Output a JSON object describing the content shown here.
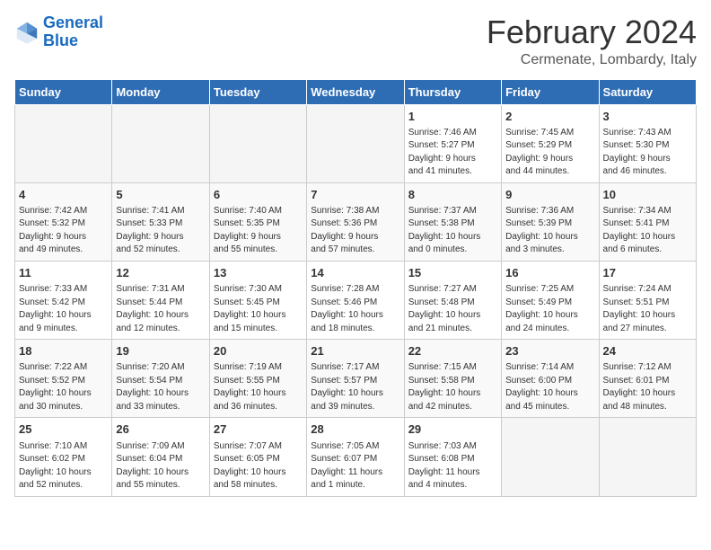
{
  "header": {
    "logo_general": "General",
    "logo_blue": "Blue",
    "month_title": "February 2024",
    "location": "Cermenate, Lombardy, Italy"
  },
  "calendar": {
    "days_of_week": [
      "Sunday",
      "Monday",
      "Tuesday",
      "Wednesday",
      "Thursday",
      "Friday",
      "Saturday"
    ],
    "weeks": [
      [
        {
          "day": "",
          "data": ""
        },
        {
          "day": "",
          "data": ""
        },
        {
          "day": "",
          "data": ""
        },
        {
          "day": "",
          "data": ""
        },
        {
          "day": "1",
          "data": "Sunrise: 7:46 AM\nSunset: 5:27 PM\nDaylight: 9 hours\nand 41 minutes."
        },
        {
          "day": "2",
          "data": "Sunrise: 7:45 AM\nSunset: 5:29 PM\nDaylight: 9 hours\nand 44 minutes."
        },
        {
          "day": "3",
          "data": "Sunrise: 7:43 AM\nSunset: 5:30 PM\nDaylight: 9 hours\nand 46 minutes."
        }
      ],
      [
        {
          "day": "4",
          "data": "Sunrise: 7:42 AM\nSunset: 5:32 PM\nDaylight: 9 hours\nand 49 minutes."
        },
        {
          "day": "5",
          "data": "Sunrise: 7:41 AM\nSunset: 5:33 PM\nDaylight: 9 hours\nand 52 minutes."
        },
        {
          "day": "6",
          "data": "Sunrise: 7:40 AM\nSunset: 5:35 PM\nDaylight: 9 hours\nand 55 minutes."
        },
        {
          "day": "7",
          "data": "Sunrise: 7:38 AM\nSunset: 5:36 PM\nDaylight: 9 hours\nand 57 minutes."
        },
        {
          "day": "8",
          "data": "Sunrise: 7:37 AM\nSunset: 5:38 PM\nDaylight: 10 hours\nand 0 minutes."
        },
        {
          "day": "9",
          "data": "Sunrise: 7:36 AM\nSunset: 5:39 PM\nDaylight: 10 hours\nand 3 minutes."
        },
        {
          "day": "10",
          "data": "Sunrise: 7:34 AM\nSunset: 5:41 PM\nDaylight: 10 hours\nand 6 minutes."
        }
      ],
      [
        {
          "day": "11",
          "data": "Sunrise: 7:33 AM\nSunset: 5:42 PM\nDaylight: 10 hours\nand 9 minutes."
        },
        {
          "day": "12",
          "data": "Sunrise: 7:31 AM\nSunset: 5:44 PM\nDaylight: 10 hours\nand 12 minutes."
        },
        {
          "day": "13",
          "data": "Sunrise: 7:30 AM\nSunset: 5:45 PM\nDaylight: 10 hours\nand 15 minutes."
        },
        {
          "day": "14",
          "data": "Sunrise: 7:28 AM\nSunset: 5:46 PM\nDaylight: 10 hours\nand 18 minutes."
        },
        {
          "day": "15",
          "data": "Sunrise: 7:27 AM\nSunset: 5:48 PM\nDaylight: 10 hours\nand 21 minutes."
        },
        {
          "day": "16",
          "data": "Sunrise: 7:25 AM\nSunset: 5:49 PM\nDaylight: 10 hours\nand 24 minutes."
        },
        {
          "day": "17",
          "data": "Sunrise: 7:24 AM\nSunset: 5:51 PM\nDaylight: 10 hours\nand 27 minutes."
        }
      ],
      [
        {
          "day": "18",
          "data": "Sunrise: 7:22 AM\nSunset: 5:52 PM\nDaylight: 10 hours\nand 30 minutes."
        },
        {
          "day": "19",
          "data": "Sunrise: 7:20 AM\nSunset: 5:54 PM\nDaylight: 10 hours\nand 33 minutes."
        },
        {
          "day": "20",
          "data": "Sunrise: 7:19 AM\nSunset: 5:55 PM\nDaylight: 10 hours\nand 36 minutes."
        },
        {
          "day": "21",
          "data": "Sunrise: 7:17 AM\nSunset: 5:57 PM\nDaylight: 10 hours\nand 39 minutes."
        },
        {
          "day": "22",
          "data": "Sunrise: 7:15 AM\nSunset: 5:58 PM\nDaylight: 10 hours\nand 42 minutes."
        },
        {
          "day": "23",
          "data": "Sunrise: 7:14 AM\nSunset: 6:00 PM\nDaylight: 10 hours\nand 45 minutes."
        },
        {
          "day": "24",
          "data": "Sunrise: 7:12 AM\nSunset: 6:01 PM\nDaylight: 10 hours\nand 48 minutes."
        }
      ],
      [
        {
          "day": "25",
          "data": "Sunrise: 7:10 AM\nSunset: 6:02 PM\nDaylight: 10 hours\nand 52 minutes."
        },
        {
          "day": "26",
          "data": "Sunrise: 7:09 AM\nSunset: 6:04 PM\nDaylight: 10 hours\nand 55 minutes."
        },
        {
          "day": "27",
          "data": "Sunrise: 7:07 AM\nSunset: 6:05 PM\nDaylight: 10 hours\nand 58 minutes."
        },
        {
          "day": "28",
          "data": "Sunrise: 7:05 AM\nSunset: 6:07 PM\nDaylight: 11 hours\nand 1 minute."
        },
        {
          "day": "29",
          "data": "Sunrise: 7:03 AM\nSunset: 6:08 PM\nDaylight: 11 hours\nand 4 minutes."
        },
        {
          "day": "",
          "data": ""
        },
        {
          "day": "",
          "data": ""
        }
      ]
    ]
  }
}
